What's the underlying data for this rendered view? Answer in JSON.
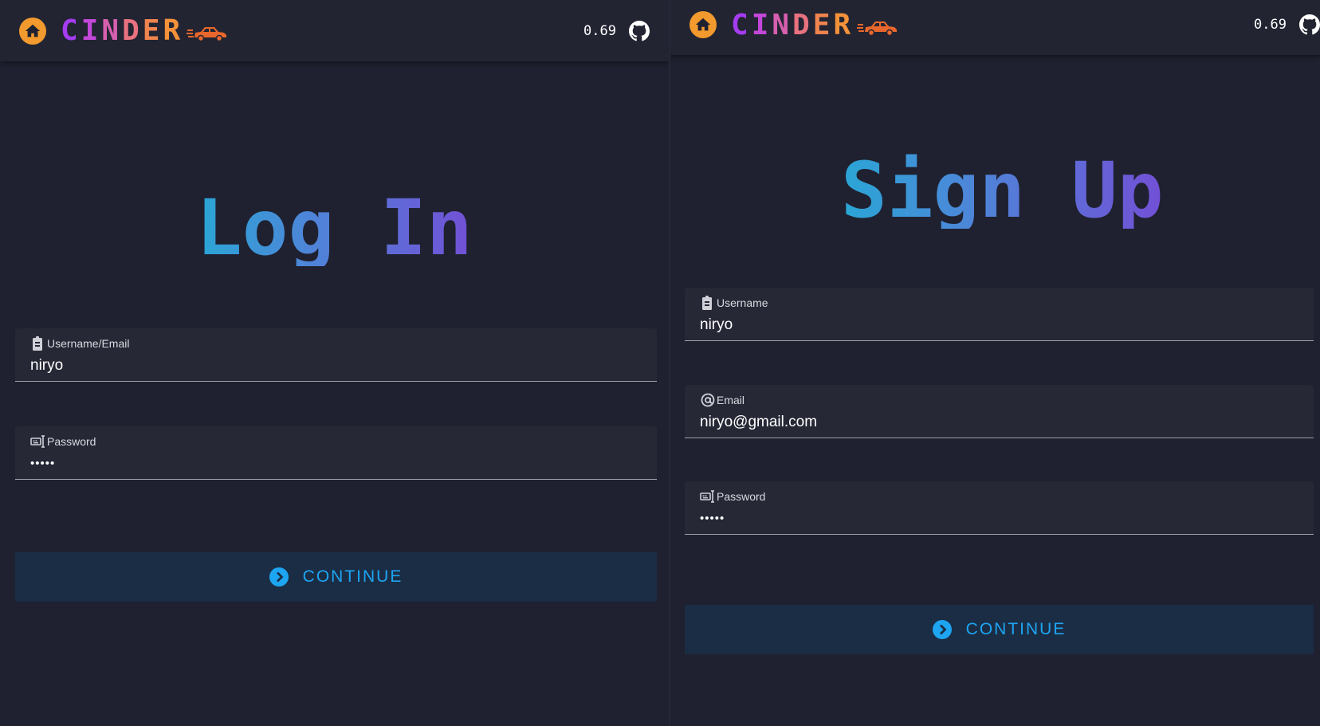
{
  "colors": {
    "background": "#1f2130",
    "appbar": "#222432",
    "home_button": "#f29a2e",
    "field_background": "#262836",
    "button_background": "#1b2d45",
    "button_text": "#1da5f2",
    "heading_gradient_start": "#2aa6d6",
    "heading_gradient_end": "#7250d6"
  },
  "login": {
    "appbar": {
      "home_icon": "home-icon",
      "brand_letters": [
        "C",
        "I",
        "N",
        "D",
        "E",
        "R"
      ],
      "brand_icon": "car-icon",
      "version": "0.69",
      "github_icon": "github-icon"
    },
    "heading": "Log In",
    "fields": [
      {
        "icon": "badge-icon",
        "label": "Username/Email",
        "value": "niryo"
      },
      {
        "icon": "keyboard-icon",
        "label": "Password",
        "value": "•••••"
      }
    ],
    "button": {
      "icon": "chevron-right-circle-icon",
      "label": "CONTINUE"
    }
  },
  "signup": {
    "appbar": {
      "home_icon": "home-icon",
      "brand_letters": [
        "C",
        "I",
        "N",
        "D",
        "E",
        "R"
      ],
      "brand_icon": "car-icon",
      "version": "0.69",
      "github_icon": "github-icon"
    },
    "heading": "Sign Up",
    "fields": [
      {
        "icon": "badge-icon",
        "label": "Username",
        "value": "niryo"
      },
      {
        "icon": "at-icon",
        "label": "Email",
        "value": "niryo@gmail.com"
      },
      {
        "icon": "keyboard-icon",
        "label": "Password",
        "value": "•••••"
      }
    ],
    "button": {
      "icon": "chevron-right-circle-icon",
      "label": "CONTINUE"
    }
  }
}
